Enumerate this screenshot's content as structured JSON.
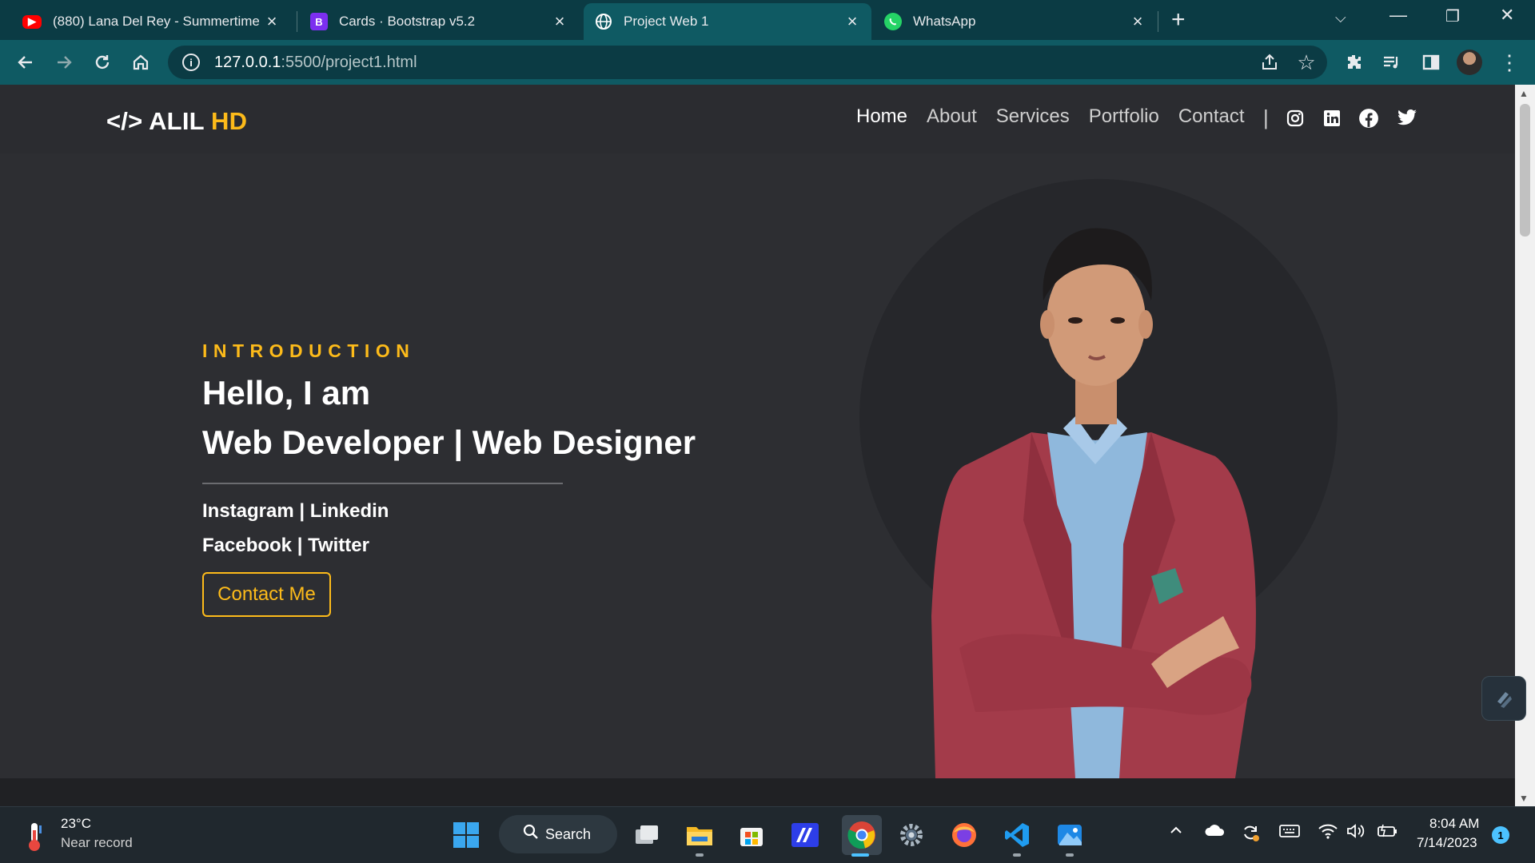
{
  "browser": {
    "tabs": [
      {
        "title": "(880) Lana Del Rey - Summertime",
        "icon": "youtube-icon"
      },
      {
        "title": "Cards · Bootstrap v5.2",
        "icon": "bootstrap-icon",
        "icon_glyph": "B"
      },
      {
        "title": "Project Web 1",
        "icon": "globe-icon"
      },
      {
        "title": "WhatsApp",
        "icon": "whatsapp-icon"
      }
    ],
    "active_tab_index": 2,
    "url_host": "127.0.0.1",
    "url_path": ":5500/project1.html",
    "colors": {
      "tabbar": "#0b3b44",
      "toolbar": "#0f5a63"
    }
  },
  "site": {
    "logo_symbol": "</>",
    "logo_name": "ALIL",
    "logo_accent": "HD",
    "nav": [
      "Home",
      "About",
      "Services",
      "Portfolio",
      "Contact"
    ],
    "nav_divider": "|",
    "social_icons": [
      "instagram-icon",
      "linkedin-icon",
      "facebook-icon",
      "twitter-icon"
    ],
    "hero": {
      "eyebrow": "INTRODUCTION",
      "greeting": "Hello, I am",
      "role": "Web Developer | Web Designer",
      "links_line1": "Instagram | Linkedin",
      "links_line2": "Facebook | Twitter",
      "cta": "Contact Me"
    },
    "colors": {
      "accent": "#fdbb1a",
      "background": "#2d2e32"
    }
  },
  "taskbar": {
    "weather_temp": "23°C",
    "weather_desc": "Near record",
    "search_label": "Search",
    "time": "8:04 AM",
    "date": "7/14/2023",
    "notification_count": "1"
  }
}
